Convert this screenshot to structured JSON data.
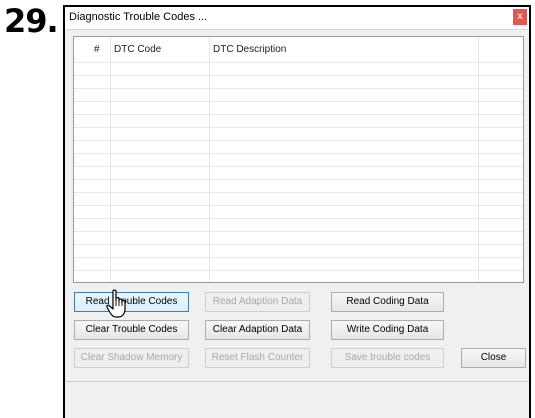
{
  "step_label": "29.",
  "window": {
    "title": "Diagnostic Trouble Codes ...",
    "close_glyph": "x"
  },
  "listview": {
    "columns": [
      "#",
      "DTC Code",
      "DTC Description"
    ],
    "rows": []
  },
  "buttons": {
    "read_trouble_codes": "Read Trouble Codes",
    "read_adaption_data": "Read Adaption Data",
    "read_coding_data": "Read Coding Data",
    "clear_trouble_codes": "Clear Trouble Codes",
    "clear_adaption_data": "Clear Adaption Data",
    "write_coding_data": "Write Coding Data",
    "clear_shadow_memory": "Clear Shadow Memory",
    "reset_flash_counter": "Reset Flash Counter",
    "save_trouble_codes": "Save trouble codes",
    "close": "Close"
  },
  "icons": {
    "cursor": "hand-pointer-icon",
    "close": "close-icon"
  }
}
